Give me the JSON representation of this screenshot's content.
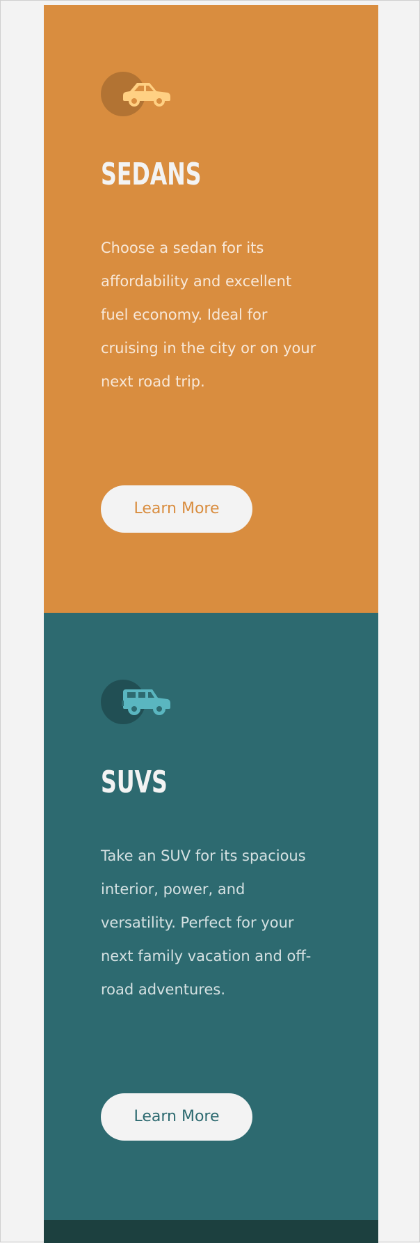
{
  "cards": [
    {
      "id": "sedans",
      "icon": "sedan-car-icon",
      "title": "SEDANS",
      "description": "Choose a sedan for its affordability and excellent fuel economy. Ideal for cruising in the city or on your next road trip.",
      "button_label": "Learn More",
      "color": "#d98d3f",
      "icon_color": "#ffd083"
    },
    {
      "id": "suvs",
      "icon": "suv-car-icon",
      "title": "SUVS",
      "description": "Take an SUV for its spacious interior, power, and versatility. Perfect for your next family vacation and off-road adventures.",
      "button_label": "Learn More",
      "color": "#2d6a70",
      "icon_color": "#5ab6c0"
    },
    {
      "id": "luxury",
      "color": "#1c403f"
    }
  ],
  "page_background": "#f2f2f2"
}
